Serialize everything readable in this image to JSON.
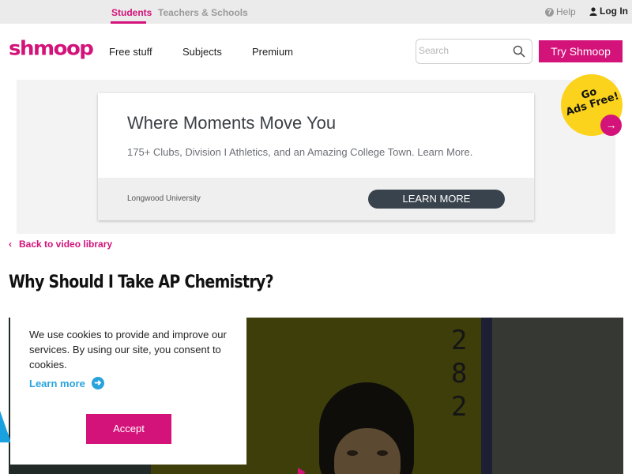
{
  "topbar": {
    "students_tab": "Students",
    "teachers_tab": "Teachers & Schools",
    "help_label": "Help",
    "login_label": "Log In"
  },
  "nav": {
    "logo_text": "shmoop",
    "items": [
      {
        "label": "Free stuff"
      },
      {
        "label": "Subjects"
      },
      {
        "label": "Premium"
      }
    ],
    "search_placeholder": "Search",
    "try_button": "Try Shmoop"
  },
  "ad": {
    "title": "Where Moments Move You",
    "subtitle": "175+ Clubs, Division I Athletics, and an Amazing College Town. Learn More.",
    "advertiser": "Longwood University",
    "cta": "LEARN MORE"
  },
  "badge": {
    "line1": "Go",
    "line2": "Ads Free!"
  },
  "content": {
    "back_link": "Back to video library",
    "title": "Why Should I Take AP Chemistry?"
  },
  "video": {
    "digits": [
      "2",
      "8",
      "2"
    ]
  },
  "cookie": {
    "message": "We use cookies to provide and improve our services. By using our site, you consent to cookies.",
    "learn_more": "Learn more",
    "accept": "Accept"
  },
  "colors": {
    "brand": "#d3127a",
    "link_blue": "#2aa3dd",
    "badge_yellow": "#fcd31c",
    "ad_button": "#39434d"
  }
}
